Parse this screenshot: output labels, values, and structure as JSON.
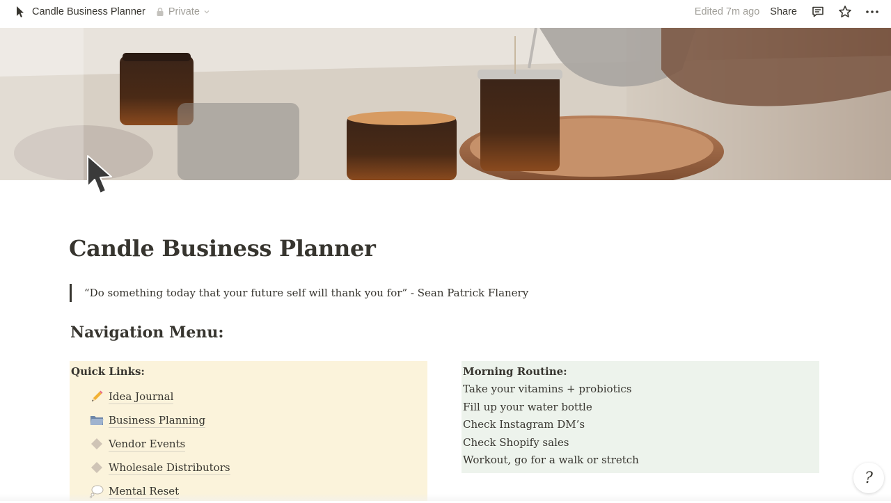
{
  "topbar": {
    "page_icon": "cursor-arrow-icon",
    "title": "Candle Business Planner",
    "privacy_icon": "lock-icon",
    "privacy_label": "Private",
    "edited_label": "Edited 7m ago",
    "share_label": "Share",
    "actions": [
      "comment-icon",
      "star-icon",
      "more-icon"
    ]
  },
  "cover": {
    "description_icon": "cover-image-candles"
  },
  "page": {
    "title": "Candle Business Planner",
    "quote": "“Do something today that your future self will thank you for” - Sean Patrick Flanery",
    "nav_heading": "Navigation Menu:"
  },
  "quick_links": {
    "heading": "Quick Links:",
    "items": [
      {
        "icon": "pencil-icon",
        "label": "Idea Journal"
      },
      {
        "icon": "folder-icon",
        "label": "Business Planning"
      },
      {
        "icon": "diamond-icon",
        "label": "Vendor Events"
      },
      {
        "icon": "diamond-icon",
        "label": "Wholesale Distributors"
      },
      {
        "icon": "thought-bubble-icon",
        "label": "Mental Reset"
      }
    ]
  },
  "morning_routine": {
    "heading": "Morning Routine:",
    "items": [
      "Take your vitamins + probiotics",
      "Fill up your water bottle",
      "Check Instagram DM’s",
      "Check Shopify sales",
      "Workout, go for a walk or stretch"
    ]
  },
  "colors": {
    "text": "#37352f",
    "muted": "#a19f99",
    "quick_links_bg": "#fbf3db",
    "routine_bg": "#edf3ec"
  }
}
